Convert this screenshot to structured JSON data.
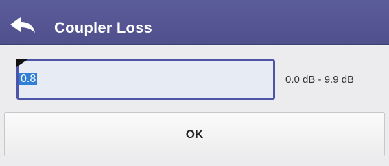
{
  "header": {
    "title": "Coupler Loss",
    "back_icon": "back-arrow-icon",
    "background": "#5b5c9a"
  },
  "field": {
    "value": "0.8",
    "range": "0.0 dB - 9.9 dB",
    "border_color": "#4c55a6",
    "selection_color": "#2f7fd6"
  },
  "actions": {
    "ok_label": "OK"
  }
}
